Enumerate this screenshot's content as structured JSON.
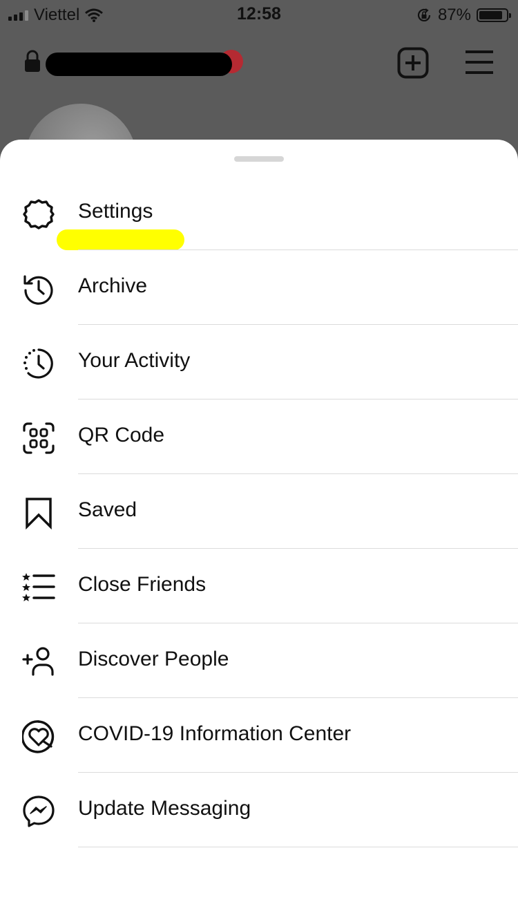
{
  "status_bar": {
    "carrier": "Viettel",
    "time": "12:58",
    "battery_percent": "87%",
    "battery_level": 0.87
  },
  "colors": {
    "accent_highlight": "#ffff00",
    "notification": "#b52a32",
    "divider": "#dbdbdb"
  },
  "header": {
    "new_post_icon": "plus-square-icon",
    "menu_icon": "hamburger-icon",
    "lock_icon": "lock-icon"
  },
  "menu": {
    "items": [
      {
        "label": "Settings",
        "icon": "settings-gear-icon"
      },
      {
        "label": "Archive",
        "icon": "archive-history-icon"
      },
      {
        "label": "Your Activity",
        "icon": "activity-clock-icon"
      },
      {
        "label": "QR Code",
        "icon": "qr-code-icon"
      },
      {
        "label": "Saved",
        "icon": "bookmark-icon"
      },
      {
        "label": "Close Friends",
        "icon": "close-friends-list-icon"
      },
      {
        "label": "Discover People",
        "icon": "add-person-icon"
      },
      {
        "label": "COVID-19 Information Center",
        "icon": "covid-heart-icon"
      },
      {
        "label": "Update Messaging",
        "icon": "messenger-icon"
      }
    ]
  }
}
